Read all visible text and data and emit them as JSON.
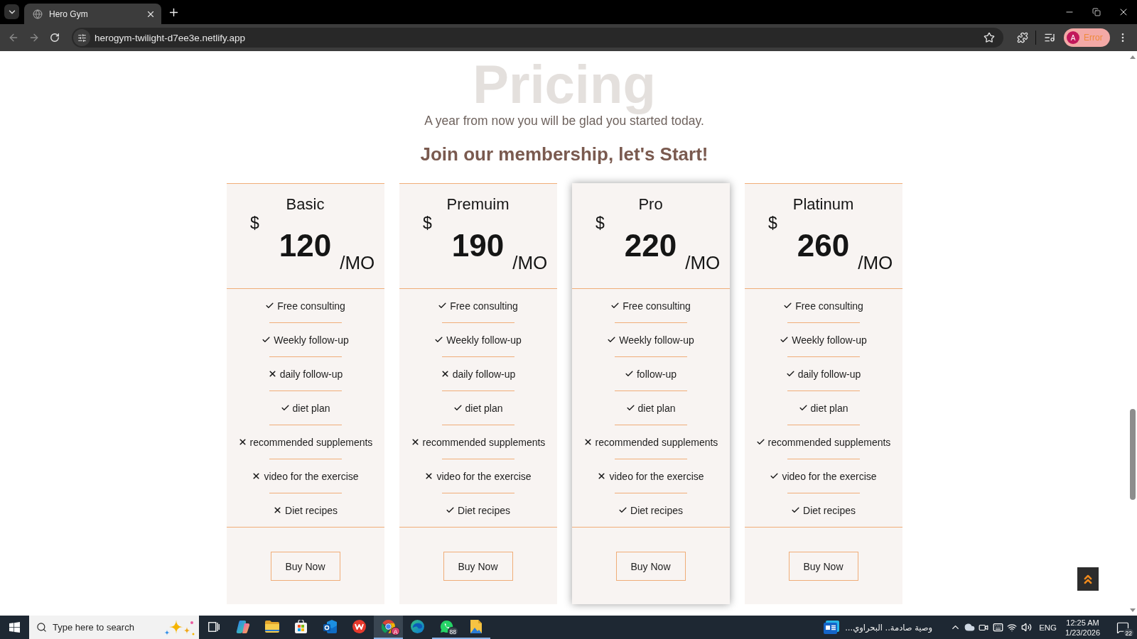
{
  "browser": {
    "tabs": [
      {
        "title": "Hero Gym",
        "selected": true
      }
    ],
    "url": "herogym-twilight-d7ee3e.netlify.app",
    "profile": {
      "initial": "A",
      "label": "Error"
    }
  },
  "page": {
    "title": "Pricing",
    "subtitle": "A year from now you will be glad you started today.",
    "heading": "Join our membership, let's Start!",
    "plans": [
      {
        "name": "Basic",
        "currency": "$",
        "price": "120",
        "period": "/MO",
        "highlighted": false,
        "features": [
          {
            "label": "Free consulting",
            "included": true
          },
          {
            "label": "Weekly follow-up",
            "included": true
          },
          {
            "label": "daily follow-up",
            "included": false
          },
          {
            "label": "diet plan",
            "included": true
          },
          {
            "label": "recommended supplements",
            "included": false
          },
          {
            "label": "video for the exercise",
            "included": false
          },
          {
            "label": "Diet recipes",
            "included": false
          }
        ],
        "button": "Buy Now"
      },
      {
        "name": "Premuim",
        "currency": "$",
        "price": "190",
        "period": "/MO",
        "highlighted": false,
        "features": [
          {
            "label": "Free consulting",
            "included": true
          },
          {
            "label": "Weekly follow-up",
            "included": true
          },
          {
            "label": "daily follow-up",
            "included": false
          },
          {
            "label": "diet plan",
            "included": true
          },
          {
            "label": "recommended supplements",
            "included": false
          },
          {
            "label": "video for the exercise",
            "included": false
          },
          {
            "label": "Diet recipes",
            "included": true
          }
        ],
        "button": "Buy Now"
      },
      {
        "name": "Pro",
        "currency": "$",
        "price": "220",
        "period": "/MO",
        "highlighted": true,
        "features": [
          {
            "label": "Free consulting",
            "included": true
          },
          {
            "label": "Weekly follow-up",
            "included": true
          },
          {
            "label": "follow-up",
            "included": true
          },
          {
            "label": "diet plan",
            "included": true
          },
          {
            "label": "recommended supplements",
            "included": false
          },
          {
            "label": "video for the exercise",
            "included": false
          },
          {
            "label": "Diet recipes",
            "included": true
          }
        ],
        "button": "Buy Now"
      },
      {
        "name": "Platinum",
        "currency": "$",
        "price": "260",
        "period": "/MO",
        "highlighted": false,
        "features": [
          {
            "label": "Free consulting",
            "included": true
          },
          {
            "label": "Weekly follow-up",
            "included": true
          },
          {
            "label": "daily follow-up",
            "included": true
          },
          {
            "label": "diet plan",
            "included": true
          },
          {
            "label": "recommended supplements",
            "included": true
          },
          {
            "label": "video for the exercise",
            "included": true
          },
          {
            "label": "Diet recipes",
            "included": true
          }
        ],
        "button": "Buy Now"
      }
    ]
  },
  "taskbar": {
    "search": {
      "placeholder": "Type here to search"
    },
    "apps": [
      {
        "kind": "task-view",
        "selected": false,
        "open": false
      },
      {
        "kind": "assistant",
        "selected": false,
        "open": false
      },
      {
        "kind": "folder",
        "selected": false,
        "open": false
      },
      {
        "kind": "store",
        "selected": false,
        "open": false
      },
      {
        "kind": "mail",
        "selected": false,
        "open": false
      },
      {
        "kind": "office",
        "selected": false,
        "open": false
      },
      {
        "kind": "browser",
        "selected": true,
        "open": true,
        "badge": "A"
      },
      {
        "kind": "browser-2",
        "selected": false,
        "open": false
      },
      {
        "kind": "chat",
        "selected": false,
        "open": true,
        "badge": "88"
      },
      {
        "kind": "image",
        "selected": false,
        "open": true
      }
    ],
    "news": {
      "headline": "وصية صادمة.. البحراوي..."
    },
    "tray": {
      "language": "ENG",
      "time": "12:25 AM",
      "date": "1/23/2026",
      "notifications": "22"
    }
  }
}
